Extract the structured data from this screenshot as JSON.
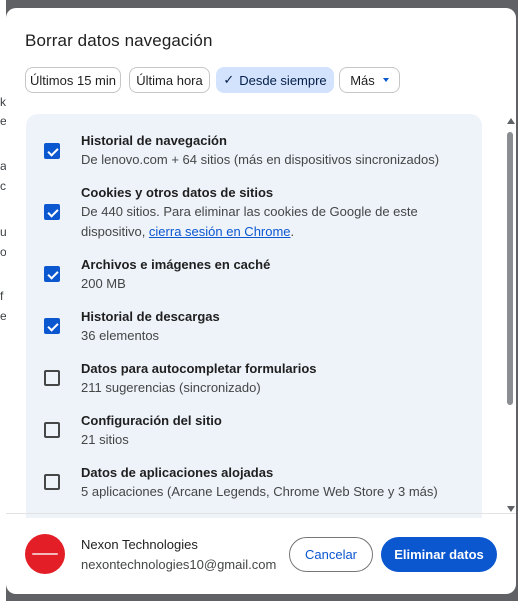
{
  "background_fragments": [
    "",
    "k",
    "e",
    "a",
    "c",
    "u",
    "o",
    "f",
    "e"
  ],
  "dialog": {
    "title": "Borrar datos navegación"
  },
  "time_range": {
    "chips": [
      {
        "label": "Últimos 15 min",
        "selected": false
      },
      {
        "label": "Última hora",
        "selected": false
      },
      {
        "label": "Desde siempre",
        "selected": true
      },
      {
        "label": "Más",
        "selected": false
      }
    ]
  },
  "items": [
    {
      "title": "Historial de navegación",
      "desc": "De lenovo.com + 64 sitios (más en dispositivos sincronizados)",
      "checked": true
    },
    {
      "title": "Cookies y otros datos de sitios",
      "desc_prefix": "De 440 sitios. Para eliminar las cookies de Google de este dispositivo, ",
      "desc_link": "cierra sesión en Chrome",
      "desc_suffix": ".",
      "checked": true
    },
    {
      "title": "Archivos e imágenes en caché",
      "desc": "200 MB",
      "checked": true
    },
    {
      "title": "Historial de descargas",
      "desc": "36 elementos",
      "checked": true
    },
    {
      "title": "Datos para autocompletar formularios",
      "desc": "211 sugerencias (sincronizado)",
      "checked": false
    },
    {
      "title": "Configuración del sitio",
      "desc": "21 sitios",
      "checked": false
    },
    {
      "title": "Datos de aplicaciones alojadas",
      "desc": "5 aplicaciones (Arcane Legends, Chrome Web Store y 3 más)",
      "checked": false
    }
  ],
  "account": {
    "name": "Nexon Technologies",
    "email": "nexontechnologies10@gmail.com",
    "avatar_color": "#e41e26"
  },
  "buttons": {
    "cancel": "Cancelar",
    "delete": "Eliminar datos"
  },
  "colors": {
    "accent": "#0b57d0",
    "selected_chip": "#d3e3fd",
    "panel": "#eef2f9"
  }
}
